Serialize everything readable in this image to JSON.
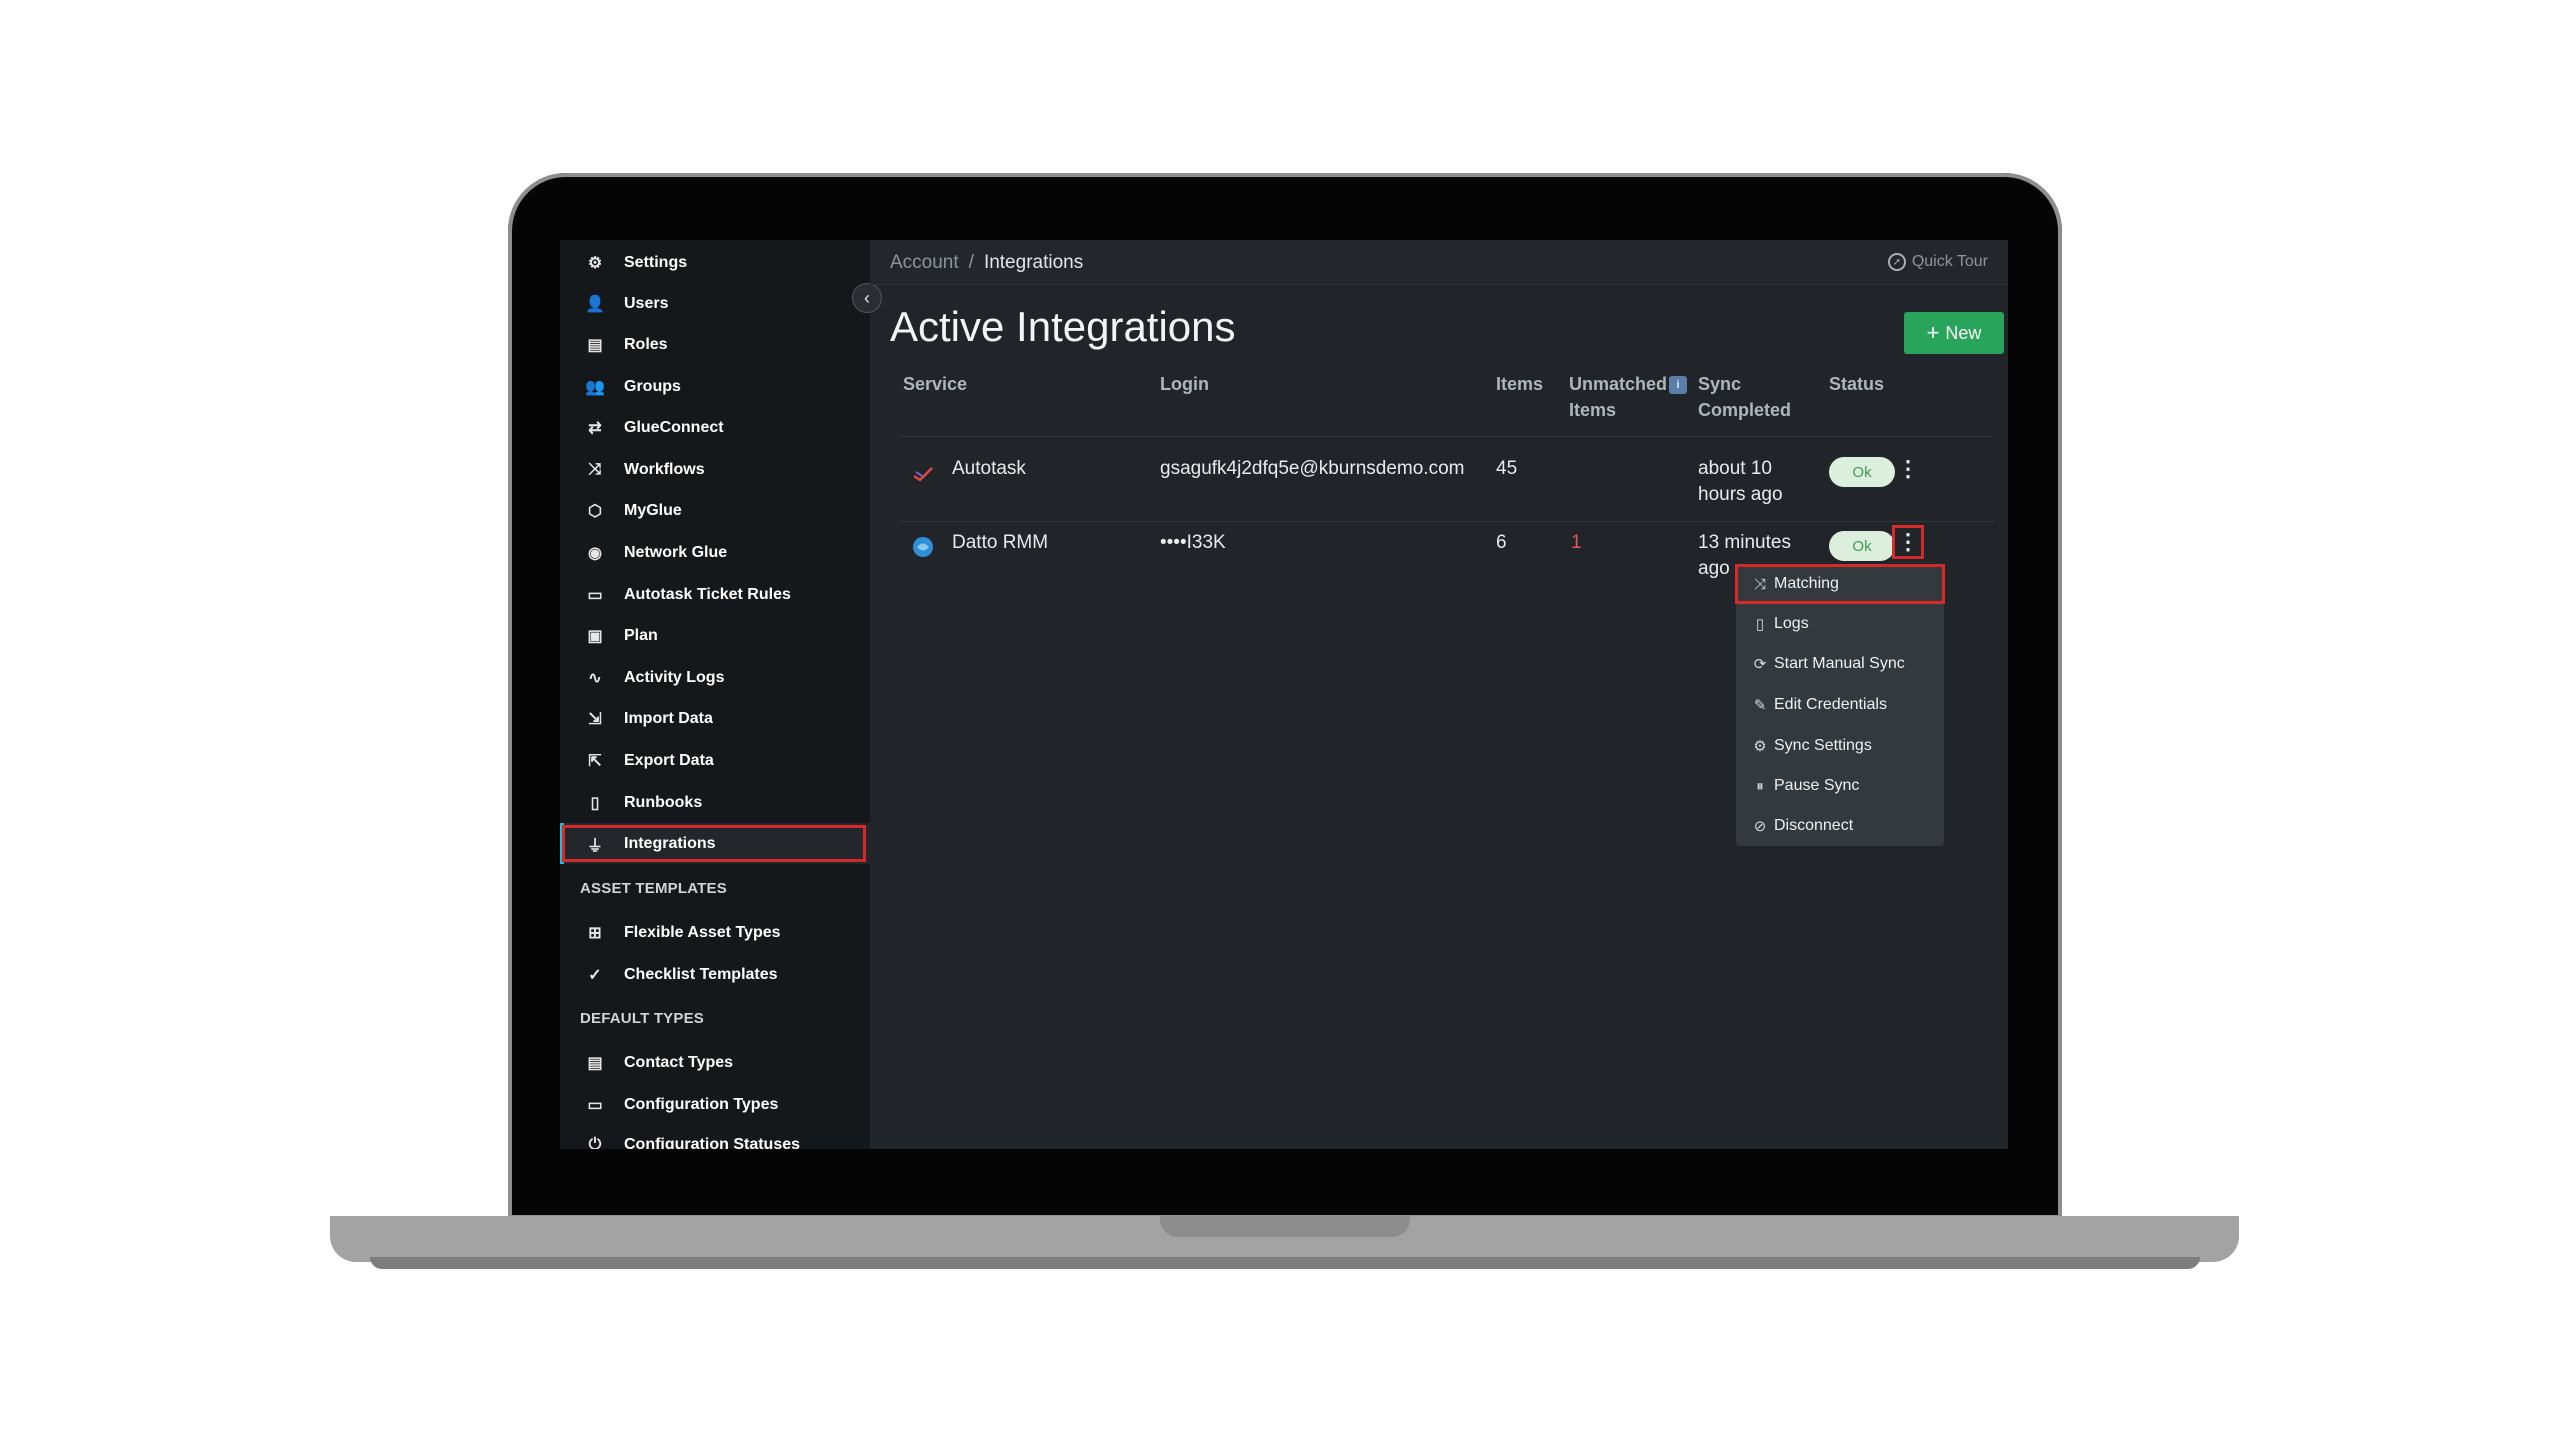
{
  "sidebar": {
    "items": [
      {
        "label": "Settings",
        "icon": "gear-icon",
        "glyph": "⚙"
      },
      {
        "label": "Users",
        "icon": "user-icon",
        "glyph": "👤"
      },
      {
        "label": "Roles",
        "icon": "id-card-icon",
        "glyph": "▤"
      },
      {
        "label": "Groups",
        "icon": "users-icon",
        "glyph": "👥"
      },
      {
        "label": "GlueConnect",
        "icon": "connect-icon",
        "glyph": "⇄"
      },
      {
        "label": "Workflows",
        "icon": "shuffle-icon",
        "glyph": "⤨"
      },
      {
        "label": "MyGlue",
        "icon": "hexagon-icon",
        "glyph": "⬡"
      },
      {
        "label": "Network Glue",
        "icon": "eye-icon",
        "glyph": "◉"
      },
      {
        "label": "Autotask Ticket Rules",
        "icon": "ticket-icon",
        "glyph": "▭"
      },
      {
        "label": "Plan",
        "icon": "money-icon",
        "glyph": "▣"
      },
      {
        "label": "Activity Logs",
        "icon": "pulse-icon",
        "glyph": "∿"
      },
      {
        "label": "Import Data",
        "icon": "file-import-icon",
        "glyph": "⇲"
      },
      {
        "label": "Export Data",
        "icon": "file-export-icon",
        "glyph": "⇱"
      },
      {
        "label": "Runbooks",
        "icon": "document-icon",
        "glyph": "▯"
      },
      {
        "label": "Integrations",
        "icon": "plug-icon",
        "glyph": "⏚",
        "active": true
      }
    ],
    "section_asset_templates": "ASSET TEMPLATES",
    "asset_templates": [
      {
        "label": "Flexible Asset Types",
        "icon": "grid-icon",
        "glyph": "⊞"
      },
      {
        "label": "Checklist Templates",
        "icon": "check-circle-icon",
        "glyph": "✓"
      }
    ],
    "section_default_types": "DEFAULT TYPES",
    "default_types": [
      {
        "label": "Contact Types",
        "icon": "address-book-icon",
        "glyph": "▤"
      },
      {
        "label": "Configuration Types",
        "icon": "monitor-icon",
        "glyph": "▭"
      },
      {
        "label": "Configuration Statuses",
        "icon": "power-icon",
        "glyph": "⏻"
      }
    ],
    "collapse_icon": "chevron-left-icon",
    "collapse_glyph": "‹"
  },
  "breadcrumb": {
    "parent": "Account",
    "separator": "/",
    "current": "Integrations"
  },
  "quick_tour": {
    "label": "Quick Tour",
    "icon": "compass-icon"
  },
  "page_title": "Active Integrations",
  "new_button": {
    "label": "New",
    "icon": "plus-icon"
  },
  "table": {
    "headers": {
      "service": "Service",
      "login": "Login",
      "items": "Items",
      "unmatched_line1": "Unmatched",
      "unmatched_line2": "Items",
      "unmatched_info": "i",
      "sync_line1": "Sync",
      "sync_line2": "Completed",
      "status": "Status"
    },
    "rows": [
      {
        "service": "Autotask",
        "service_icon": "autotask-logo-icon",
        "login": "gsagufk4j2dfq5e@kburnsdemo.com",
        "items": "45",
        "unmatched": "",
        "sync_line1": "about 10",
        "sync_line2": "hours ago",
        "status": "Ok"
      },
      {
        "service": "Datto RMM",
        "service_icon": "datto-logo-icon",
        "login": "••••I33K",
        "items": "6",
        "unmatched": "1",
        "sync_line1": "13 minutes",
        "sync_line2": "ago",
        "status": "Ok"
      }
    ]
  },
  "dropdown": {
    "items": [
      {
        "label": "Matching",
        "icon": "shuffle-icon",
        "glyph": "⤨"
      },
      {
        "label": "Logs",
        "icon": "file-icon",
        "glyph": "▯"
      },
      {
        "label": "Start Manual Sync",
        "icon": "sync-icon",
        "glyph": "⟳"
      },
      {
        "label": "Edit Credentials",
        "icon": "edit-icon",
        "glyph": "✎"
      },
      {
        "label": "Sync Settings",
        "icon": "cogs-icon",
        "glyph": "⚙"
      },
      {
        "label": "Pause Sync",
        "icon": "pause-circle-icon",
        "glyph": "⏸"
      },
      {
        "label": "Disconnect",
        "icon": "eye-slash-icon",
        "glyph": "⊘"
      }
    ]
  },
  "colors": {
    "accent_active": "#2eb6d8",
    "new_button": "#28a55a",
    "highlight_outline": "#d42a2a",
    "status_ok_bg": "#dcefdc",
    "status_ok_text": "#3f9b56",
    "unmatched_text": "#e05656"
  }
}
